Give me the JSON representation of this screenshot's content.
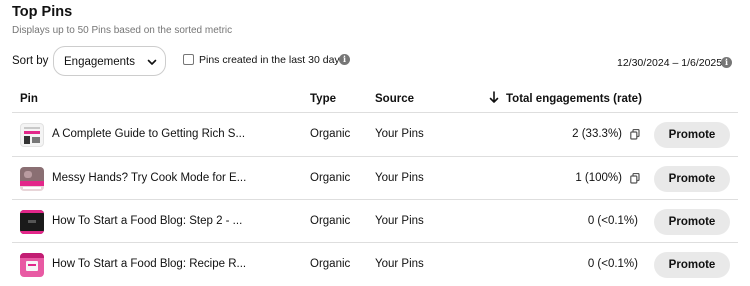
{
  "header": {
    "title": "Top Pins",
    "subtitle": "Displays up to 50 Pins based on the sorted metric"
  },
  "controls": {
    "sort_label": "Sort by",
    "sort_value": "Engagements",
    "checkbox_label": "Pins created in the last 30 days",
    "checkbox_checked": false,
    "date_range": "12/30/2024 – 1/6/2025"
  },
  "table": {
    "columns": {
      "pin": "Pin",
      "type": "Type",
      "source": "Source",
      "metric": "Total engagements (rate)"
    },
    "rows": [
      {
        "title": "A Complete Guide to Getting Rich S...",
        "type": "Organic",
        "source": "Your Pins",
        "metric": "2 (33.3%)",
        "has_copy_icon": true,
        "action": "Promote"
      },
      {
        "title": "Messy Hands? Try Cook Mode for E...",
        "type": "Organic",
        "source": "Your Pins",
        "metric": "1 (100%)",
        "has_copy_icon": true,
        "action": "Promote"
      },
      {
        "title": "How To Start a Food Blog: Step 2 - ...",
        "type": "Organic",
        "source": "Your Pins",
        "metric": "0 (<0.1%)",
        "has_copy_icon": false,
        "action": "Promote"
      },
      {
        "title": "How To Start a Food Blog: Recipe R...",
        "type": "Organic",
        "source": "Your Pins",
        "metric": "0 (<0.1%)",
        "has_copy_icon": false,
        "action": "Promote"
      }
    ]
  },
  "icons": {
    "info": "info-icon",
    "chevron": "chevron-down-icon",
    "sort_arrow": "arrow-down-icon",
    "copy": "copy-icon"
  },
  "colors": {
    "button_bg": "#e9e9e9",
    "text": "#111111",
    "muted": "#767676",
    "divider": "#dedede"
  }
}
